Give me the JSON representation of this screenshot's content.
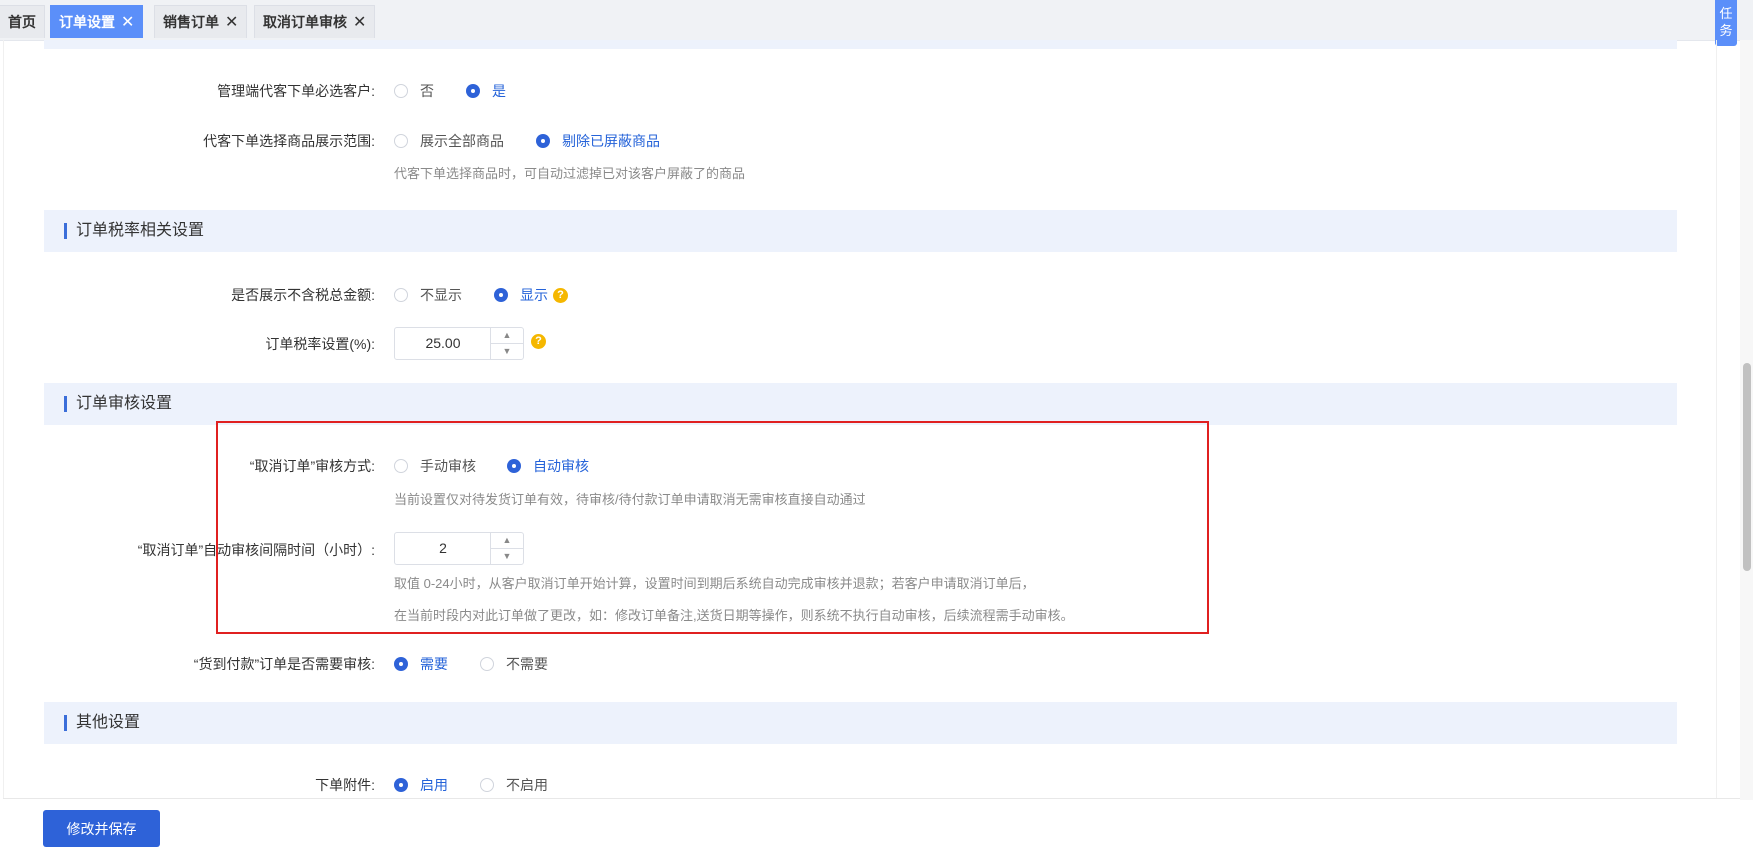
{
  "tabs": [
    {
      "label": "首页",
      "closable": false,
      "active": false
    },
    {
      "label": "订单设置",
      "closable": true,
      "active": true
    },
    {
      "label": "销售订单",
      "closable": true,
      "active": false
    },
    {
      "label": "取消订单审核",
      "closable": true,
      "active": false
    }
  ],
  "task_button": {
    "label_line1": "任",
    "label_line2": "务"
  },
  "close_glyph": "✕",
  "help_glyph": "?",
  "top_settings": {
    "must_select_customer": {
      "label": "管理端代客下单必选客户:",
      "options": [
        {
          "label": "否",
          "checked": false
        },
        {
          "label": "是",
          "checked": true
        }
      ]
    },
    "product_display_range": {
      "label": "代客下单选择商品展示范围:",
      "options": [
        {
          "label": "展示全部商品",
          "checked": false
        },
        {
          "label": "剔除已屏蔽商品",
          "checked": true
        }
      ],
      "hint": "代客下单选择商品时，可自动过滤掉已对该客户屏蔽了的商品"
    }
  },
  "tax_section": {
    "title": "订单税率相关设置",
    "show_untaxed_total": {
      "label": "是否展示不含税总金额:",
      "options": [
        {
          "label": "不显示",
          "checked": false
        },
        {
          "label": "显示",
          "checked": true
        }
      ]
    },
    "tax_rate": {
      "label": "订单税率设置(%):",
      "value": "25.00"
    }
  },
  "audit_section": {
    "title": "订单审核设置",
    "cancel_audit_mode": {
      "label": "“取消订单”审核方式:",
      "options": [
        {
          "label": "手动审核",
          "checked": false
        },
        {
          "label": "自动审核",
          "checked": true
        }
      ],
      "hint": "当前设置仅对待发货订单有效，待审核/待付款订单申请取消无需审核直接自动通过"
    },
    "auto_audit_interval": {
      "label": "“取消订单”自动审核间隔时间（小时）:",
      "value": "2",
      "hint_line1": "取值 0-24小时，从客户取消订单开始计算，设置时间到期后系统自动完成审核并退款；若客户申请取消订单后，",
      "hint_line2": "在当前时段内对此订单做了更改，如：修改订单备注,送货日期等操作，则系统不执行自动审核，后续流程需手动审核。"
    },
    "cod_audit": {
      "label": "“货到付款”订单是否需要审核:",
      "options": [
        {
          "label": "需要",
          "checked": true
        },
        {
          "label": "不需要",
          "checked": false
        }
      ]
    }
  },
  "other_section": {
    "title": "其他设置",
    "attachment": {
      "label": "下单附件:",
      "options": [
        {
          "label": "启用",
          "checked": true
        },
        {
          "label": "不启用",
          "checked": false
        }
      ]
    }
  },
  "footer": {
    "save_label": "修改并保存"
  },
  "colors": {
    "accent": "#2e62d8",
    "tab_active": "#5b8ff9",
    "section_bg": "#edf2fc",
    "highlight_box": "#e02020",
    "help": "#f5b700"
  }
}
